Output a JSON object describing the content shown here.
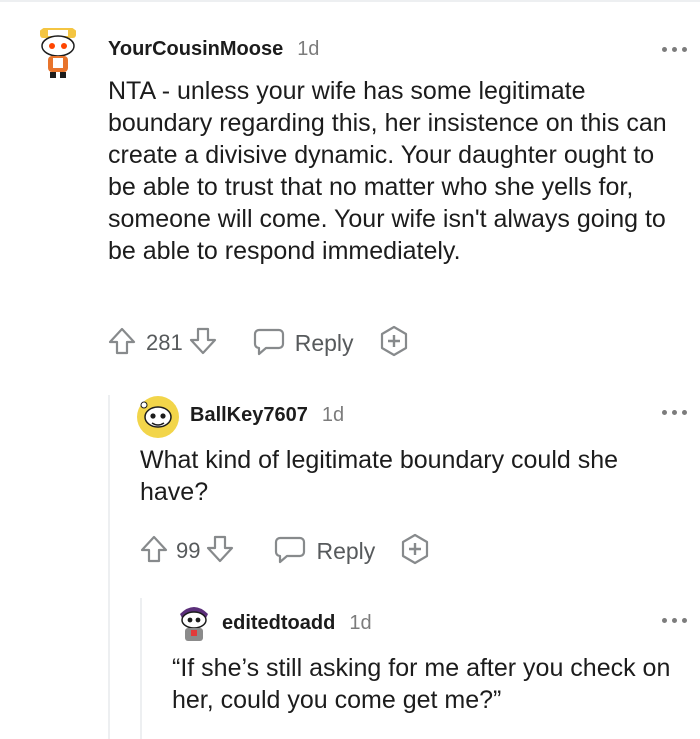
{
  "comments": [
    {
      "username": "YourCousinMoose",
      "age": "1d",
      "body": "NTA - unless your wife has some legitimate boundary regarding this, her insistence on this can create a divisive dynamic. Your daughter ought to be able to trust that no matter who she yells for, someone will come. Your wife isn't always going to be able to respond immediately.",
      "votes": "281",
      "reply_label": "Reply",
      "avatar_colors": {
        "head": "#ffffff",
        "shirt": "#e8742c",
        "eye": "#ff4500"
      }
    },
    {
      "username": "BallKey7607",
      "age": "1d",
      "body": "What kind of legitimate boundary could she have?",
      "votes": "99",
      "reply_label": "Reply",
      "avatar_colors": {
        "bg": "#f2d54a",
        "face": "#ffffff"
      }
    },
    {
      "username": "editedtoadd",
      "age": "1d",
      "body": "“If she’s still asking for me after you check on her, could you come get me?”",
      "avatar_colors": {
        "hair": "#5b2f7a",
        "shirt": "#8b8b8b",
        "accent": "#e23b3b"
      }
    }
  ],
  "icons": {
    "upvote": "upvote-arrow-icon",
    "downvote": "downvote-arrow-icon",
    "reply": "speech-bubble-icon",
    "award": "add-award-icon",
    "more": "more-options-icon"
  },
  "colors": {
    "text": "#1c1c1c",
    "meta": "#7c7c7c",
    "icon": "#878a8c",
    "thread": "#edeff1"
  }
}
